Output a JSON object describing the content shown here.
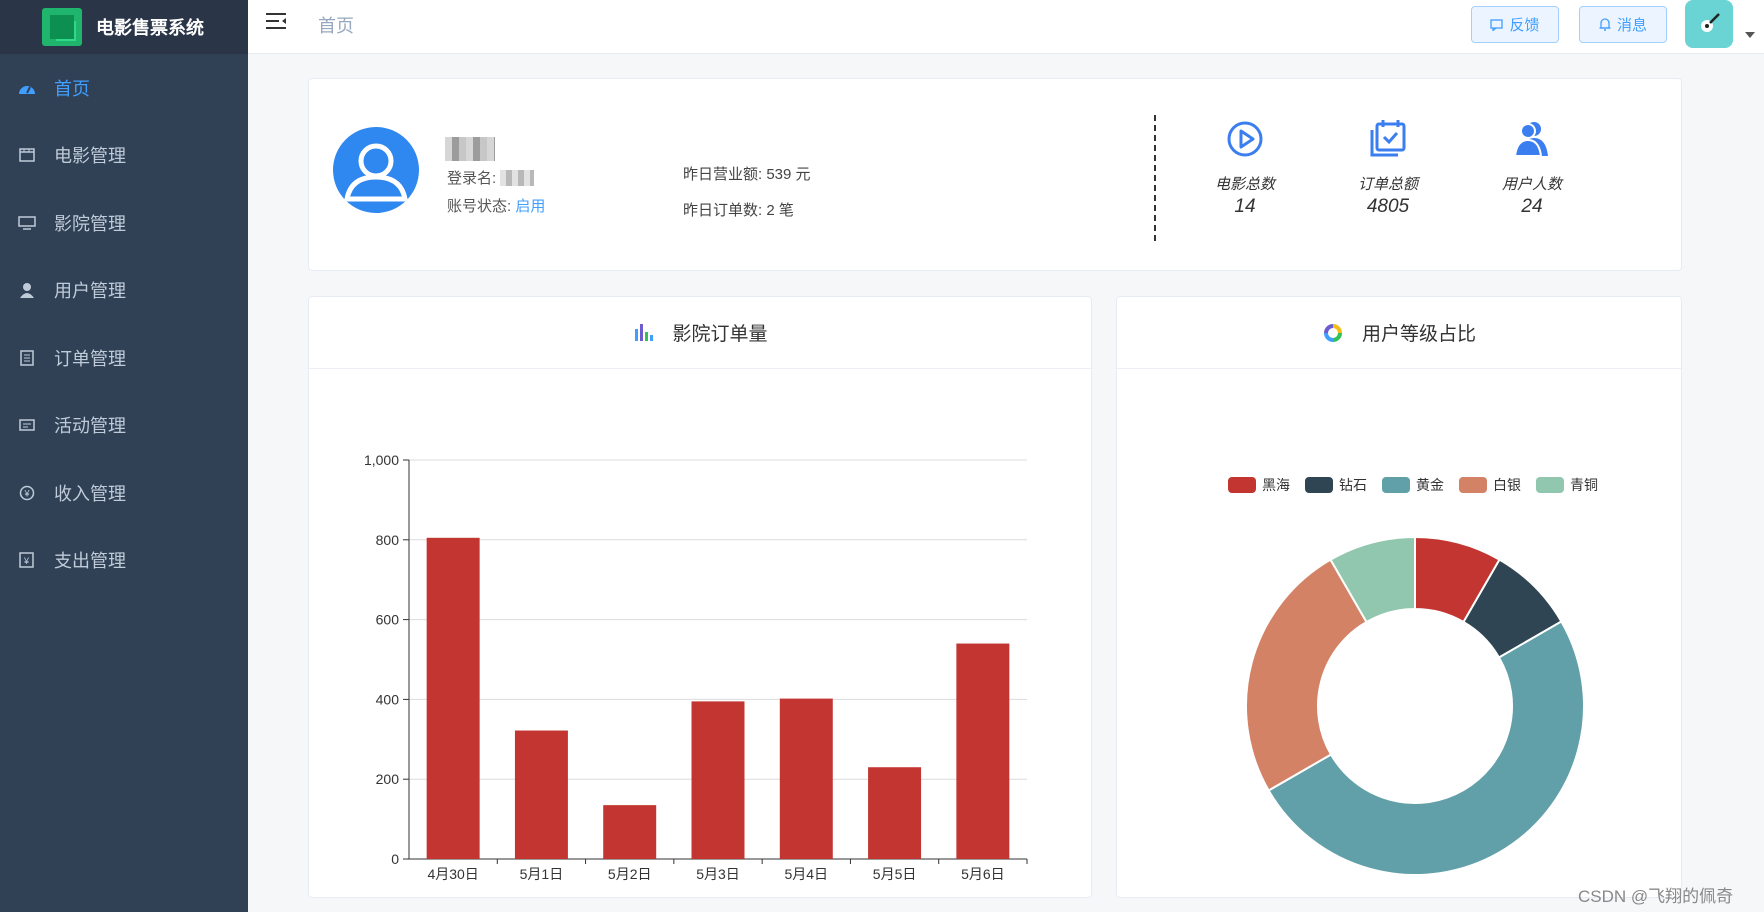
{
  "app": {
    "title": "电影售票系统"
  },
  "sidebar": {
    "items": [
      {
        "label": "首页",
        "icon": "dashboard-icon",
        "active": true
      },
      {
        "label": "电影管理",
        "icon": "film-icon",
        "active": false
      },
      {
        "label": "影院管理",
        "icon": "monitor-icon",
        "active": false
      },
      {
        "label": "用户管理",
        "icon": "user-icon",
        "active": false
      },
      {
        "label": "订单管理",
        "icon": "order-icon",
        "active": false
      },
      {
        "label": "活动管理",
        "icon": "ticket-icon",
        "active": false
      },
      {
        "label": "收入管理",
        "icon": "yen-circle-icon",
        "active": false
      },
      {
        "label": "支出管理",
        "icon": "yen-doc-icon",
        "active": false
      }
    ]
  },
  "header": {
    "breadcrumb": "首页",
    "feedback_label": "反馈",
    "message_label": "消息"
  },
  "profile": {
    "login_label": "登录名:",
    "status_label": "账号状态:",
    "status_value": "启用",
    "yesterday_revenue": "昨日营业额: 539 元",
    "yesterday_orders": "昨日订单数: 2 笔"
  },
  "stats": [
    {
      "label": "电影总数",
      "value": "14",
      "icon": "play-circle-icon"
    },
    {
      "label": "订单总额",
      "value": "4805",
      "icon": "calendar-check-icon"
    },
    {
      "label": "用户人数",
      "value": "24",
      "icon": "users-icon"
    }
  ],
  "bar_panel": {
    "title": "影院订单量",
    "icon": "bar-chart-icon"
  },
  "pie_panel": {
    "title": "用户等级占比",
    "icon": "donut-chart-icon"
  },
  "colors": {
    "accent": "#409eff",
    "sidebar": "#304156",
    "bar": "#c23531"
  },
  "chart_data": [
    {
      "type": "bar",
      "title": "影院订单量",
      "categories": [
        "4月30日",
        "5月1日",
        "5月2日",
        "5月3日",
        "5月4日",
        "5月5日",
        "5月6日"
      ],
      "values": [
        805,
        322,
        135,
        395,
        402,
        230,
        540
      ],
      "ylim": [
        0,
        1000
      ],
      "yticks": [
        "0",
        "200",
        "400",
        "600",
        "800",
        "1,000"
      ],
      "grid": true,
      "color": "#c23531"
    },
    {
      "type": "pie",
      "title": "用户等级占比",
      "donut": true,
      "legend_position": "top",
      "slices": [
        {
          "name": "黑海",
          "value": 2,
          "color": "#c23531"
        },
        {
          "name": "钻石",
          "value": 2,
          "color": "#2f4554"
        },
        {
          "name": "黄金",
          "value": 12,
          "color": "#61a0a8"
        },
        {
          "name": "白银",
          "value": 6,
          "color": "#d48265"
        },
        {
          "name": "青铜",
          "value": 2,
          "color": "#91c7ae"
        }
      ]
    }
  ],
  "watermark": "CSDN @飞翔的佩奇"
}
